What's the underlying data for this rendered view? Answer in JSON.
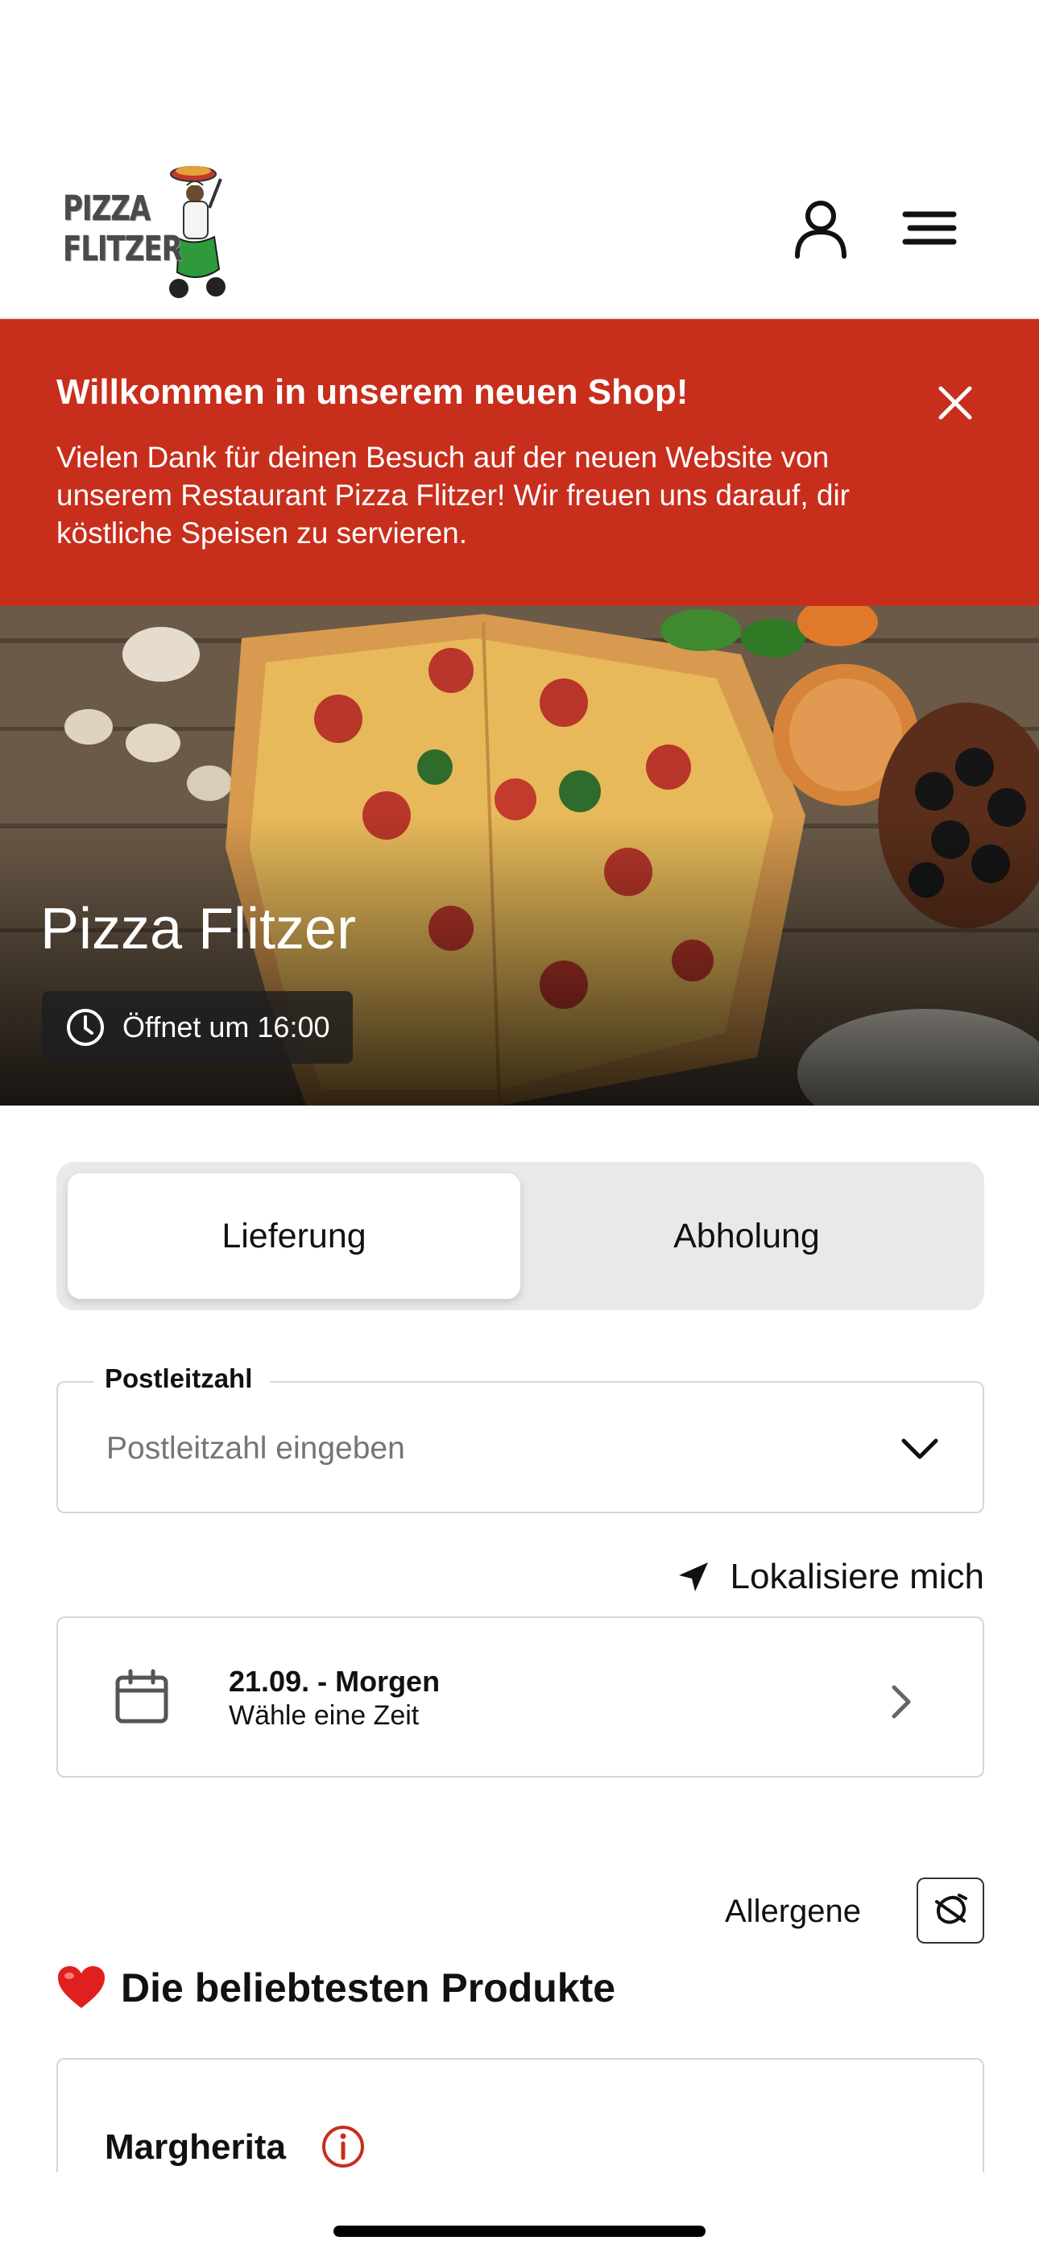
{
  "header": {
    "logo_text": "PIZZA FLITZER",
    "profile_icon": "user-icon",
    "menu_icon": "menu-icon"
  },
  "banner": {
    "title": "Willkommen in unserem neuen Shop!",
    "text": "Vielen Dank für deinen Besuch auf der neuen Website von unserem Restaurant Pizza Flitzer! Wir freuen uns darauf, dir köstliche Speisen zu servieren.",
    "close_icon": "close-icon",
    "background_color": "#c82e1c"
  },
  "hero": {
    "title": "Pizza Flitzer",
    "open_status": "Öffnet um 16:00",
    "clock_icon": "clock-icon"
  },
  "order_mode": {
    "options": [
      {
        "label": "Lieferung",
        "selected": true
      },
      {
        "label": "Abholung",
        "selected": false
      }
    ]
  },
  "postal_code": {
    "label": "Postleitzahl",
    "placeholder": "Postleitzahl eingeben",
    "value": ""
  },
  "locate": {
    "label": "Lokalisiere mich",
    "icon": "location-arrow-icon"
  },
  "date_picker": {
    "date": "21.09. - Morgen",
    "hint": "Wähle eine Zeit",
    "icon": "calendar-icon"
  },
  "allergens": {
    "label": "Allergene",
    "icon": "allergen-filter-icon"
  },
  "popular": {
    "heading": "Die beliebtesten Produkte",
    "icon": "heart-icon",
    "products": [
      {
        "name": "Margherita"
      }
    ]
  }
}
